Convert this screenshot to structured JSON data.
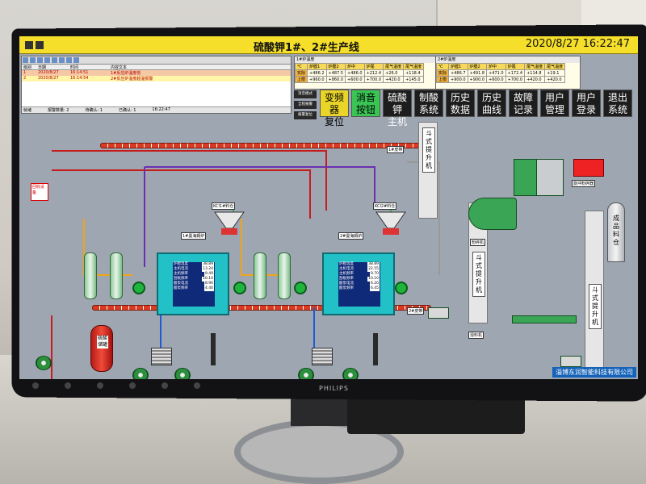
{
  "title": "硫酸钾1#、2#生产线",
  "datetime": "2020/8/27  16:22:47",
  "buttons": [
    {
      "label": "变频器\n复位",
      "style": "yellow"
    },
    {
      "label": "消音\n按钮",
      "style": "green"
    },
    {
      "label": "硫酸钾\n主机",
      "style": "dark"
    },
    {
      "label": "制酸\n系统",
      "style": "dark"
    },
    {
      "label": "历史\n数据",
      "style": "dark"
    },
    {
      "label": "历史\n曲线",
      "style": "dark"
    },
    {
      "label": "故障\n记录",
      "style": "dark"
    },
    {
      "label": "用户\n管理",
      "style": "dark"
    },
    {
      "label": "用户\n登录",
      "style": "dark"
    },
    {
      "label": "退出\n系统",
      "style": "dark"
    }
  ],
  "small_buttons": [
    "消音模式",
    "全程报警",
    "报警复位"
  ],
  "alarm_log": {
    "headers": [
      "级别",
      "日期",
      "时间",
      "内容文本"
    ],
    "rows": [
      [
        "1",
        "2020/8/27",
        "16:14:51",
        "1#反应炉温度低"
      ],
      [
        "2",
        "2020/8/27",
        "16:14:54",
        "2#反应炉温度超温报警"
      ]
    ],
    "footer": [
      "就绪",
      "报警数量: 2",
      "待确认: 1",
      "已确认: 1",
      "16:22:47"
    ]
  },
  "table1": {
    "caption": "1#炉温度",
    "headers": [
      "℃",
      "炉膛1",
      "炉膛2",
      "炉中",
      "炉尾",
      "尾气温度",
      "尾气温度"
    ],
    "rows": [
      [
        "实际",
        "+486.2",
        "+487.5",
        "+486.0",
        "+212.4",
        "+26.0",
        "+118.4"
      ],
      [
        "上限",
        "+960.0",
        "+860.0",
        "+600.0",
        "+700.0",
        "+420.0",
        "+145.0"
      ]
    ]
  },
  "table2": {
    "caption": "2#炉温度",
    "headers": [
      "℃",
      "炉膛1",
      "炉膛2",
      "炉中",
      "炉尾",
      "尾气温度",
      "尾气温度"
    ],
    "rows": [
      [
        "实际",
        "+486.7",
        "+491.8",
        "+471.0",
        "+172.4",
        "+114.8",
        "+19.1"
      ],
      [
        "上限",
        "+900.0",
        "+900.0",
        "+600.0",
        "+700.0",
        "+420.0",
        "+420.0"
      ]
    ]
  },
  "furnace1": {
    "title": "1#曼海姆炉",
    "rows": [
      [
        "炉膛温度",
        "38.89"
      ],
      [
        "主机电流",
        "13.24"
      ],
      [
        "主机频率",
        "9.49"
      ],
      [
        "刮板频率",
        "10.10"
      ],
      [
        "酸泵电流",
        "8.90"
      ],
      [
        "酸泵频率",
        "4.40"
      ]
    ]
  },
  "furnace2": {
    "title": "2#曼海姆炉",
    "rows": [
      [
        "炉膛温度",
        "38.89"
      ],
      [
        "主机电流",
        "22.55"
      ],
      [
        "主机频率",
        "9.70"
      ],
      [
        "刮板频率",
        "10.10"
      ],
      [
        "酸泵电流",
        "6.20"
      ],
      [
        "酸泵频率",
        "6.45"
      ]
    ]
  },
  "labels": {
    "kcl1": "KCl1#料仓",
    "kcl2": "KCl2#料仓",
    "elev1": "斗式提升机",
    "elev2": "斗式提升机",
    "elev3": "斗式提升机",
    "silo": "成品料仓",
    "redtank": "硫酸储罐",
    "crusher": "粉碎机",
    "mixer": "混料机",
    "feeder": "旋冲粉碎器",
    "scrubber": "尾气吸收塔",
    "belt1": "1#皮带",
    "belt2": "2#皮带",
    "company": "淄博东润智能科技有限公司"
  }
}
